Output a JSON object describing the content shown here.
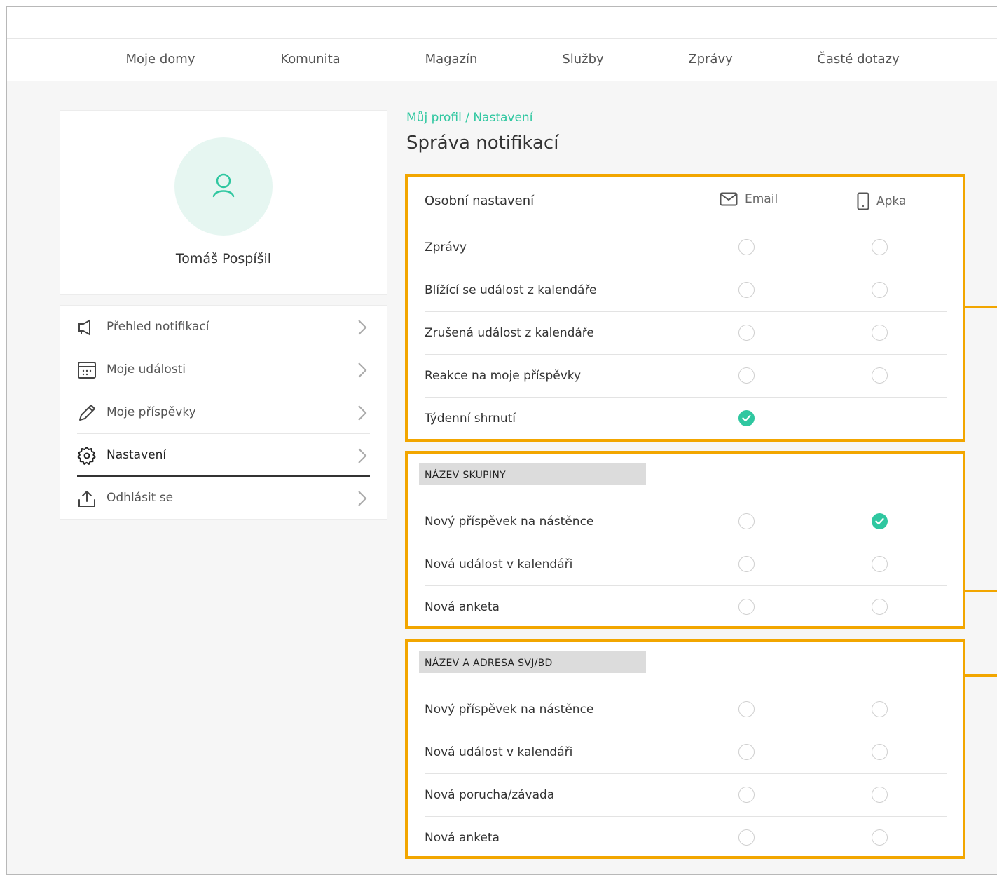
{
  "nav": {
    "items": [
      "Moje domy",
      "Komunita",
      "Magazín",
      "Služby",
      "Zprávy",
      "Časté dotazy"
    ]
  },
  "profile": {
    "name": "Tomáš Pospíšil"
  },
  "menu": {
    "items": [
      {
        "label": "Přehled notifikací",
        "icon": "megaphone-icon"
      },
      {
        "label": "Moje události",
        "icon": "calendar-icon"
      },
      {
        "label": "Moje příspěvky",
        "icon": "pencil-icon"
      },
      {
        "label": "Nastavení",
        "icon": "gear-icon",
        "active": true
      },
      {
        "label": "Odhlásit se",
        "icon": "upload-icon"
      }
    ]
  },
  "breadcrumb": "Můj profil / Nastavení",
  "title": "Správa notifikací",
  "personal": {
    "title": "Osobní nastavení",
    "col_email": "Email",
    "col_app": "Apka",
    "rows": [
      {
        "label": "Zprávy",
        "email": false,
        "app": false
      },
      {
        "label": "Blížící se událost z kalendáře",
        "email": false,
        "app": false
      },
      {
        "label": "Zrušená událost z kalendáře",
        "email": false,
        "app": false
      },
      {
        "label": "Reakce na moje příspěvky",
        "email": false,
        "app": false
      },
      {
        "label": "Týdenní shrnutí",
        "email": true,
        "app": null
      }
    ]
  },
  "group": {
    "label": "NÁZEV SKUPINY",
    "rows": [
      {
        "label": "Nový příspěvek na nástěnce",
        "email": false,
        "app": true
      },
      {
        "label": "Nová událost v kalendáři",
        "email": false,
        "app": false
      },
      {
        "label": "Nová anketa",
        "email": false,
        "app": false
      }
    ]
  },
  "svj": {
    "label": "NÁZEV A ADRESA SVJ/BD",
    "rows": [
      {
        "label": "Nový příspěvek na nástěnce",
        "email": false,
        "app": false
      },
      {
        "label": "Nová událost v kalendáři",
        "email": false,
        "app": false
      },
      {
        "label": "Nová porucha/závada",
        "email": false,
        "app": false
      },
      {
        "label": "Nová anketa",
        "email": false,
        "app": false
      }
    ]
  },
  "colors": {
    "accent": "#2fc7a0",
    "highlight": "#f2a600",
    "group_bg": "#dcdcdc"
  }
}
